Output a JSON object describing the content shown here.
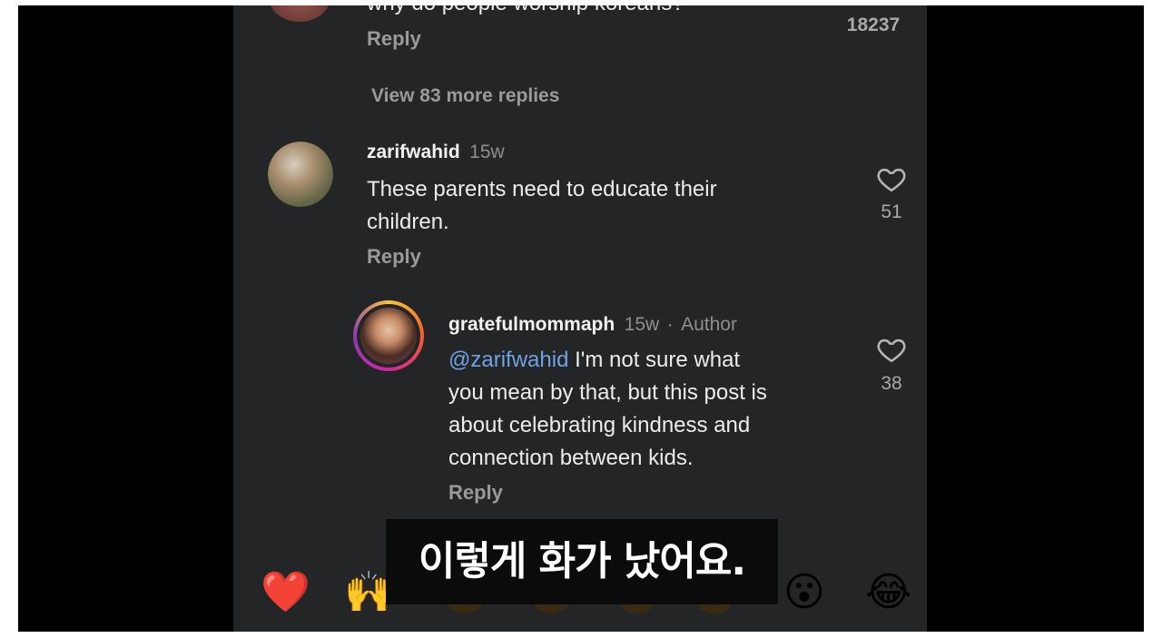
{
  "comments": [
    {
      "text": "why do people worship koreans?",
      "reply_label": "Reply",
      "like_count": "18237"
    },
    {
      "username": "zarifwahid",
      "time": "15w",
      "text_line1": "These parents need to educate their",
      "text_line2": "children.",
      "reply_label": "Reply",
      "like_count": "51"
    }
  ],
  "view_more_replies": "View 83 more replies",
  "reply": {
    "username": "gratefulmommaph",
    "time": "15w",
    "separator": "·",
    "author_badge": "Author",
    "mention": "@zarifwahid",
    "text_line1": " I'm not sure what",
    "text_line2": "you mean by that, but this post is",
    "text_line3": "about celebrating kindness and",
    "text_line4": "connection between kids.",
    "reply_label": "Reply",
    "like_count": "38"
  },
  "reactions": [
    "❤️",
    "🙌",
    "😮",
    "😂"
  ],
  "subtitle": "이렇게 화가 났어요.",
  "colors": {
    "background": "#242526",
    "mention": "#6fa3e6",
    "muted": "#9a9a9a"
  }
}
